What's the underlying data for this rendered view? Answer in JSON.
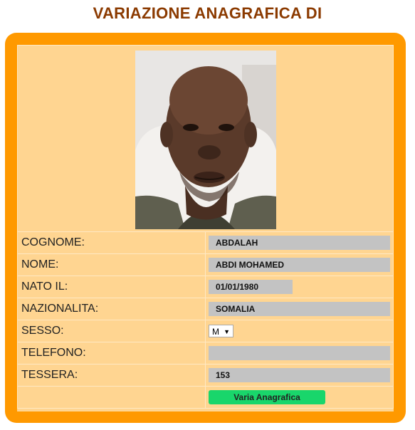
{
  "title": "VARIAZIONE ANAGRAFICA DI",
  "photo": {
    "alt": "person-photo"
  },
  "fields": {
    "cognome": {
      "label": "COGNOME:",
      "value": "ABDALAH"
    },
    "nome": {
      "label": "NOME:",
      "value": "ABDI MOHAMED"
    },
    "nato_il": {
      "label": "NATO IL:",
      "value": "01/01/1980"
    },
    "nazionalita": {
      "label": "NAZIONALITA:",
      "value": "SOMALIA"
    },
    "sesso": {
      "label": "SESSO:",
      "value": "M",
      "arrow": "▼"
    },
    "telefono": {
      "label": "TELEFONO:",
      "value": ""
    },
    "tessera": {
      "label": "TESSERA:",
      "value": "153"
    }
  },
  "submit_label": "Varia Anagrafica",
  "colors": {
    "title": "#8B3A00",
    "frame": "#FF9900",
    "panel": "#FFD591",
    "field": "#C3C3C3",
    "button": "#19D66B"
  }
}
